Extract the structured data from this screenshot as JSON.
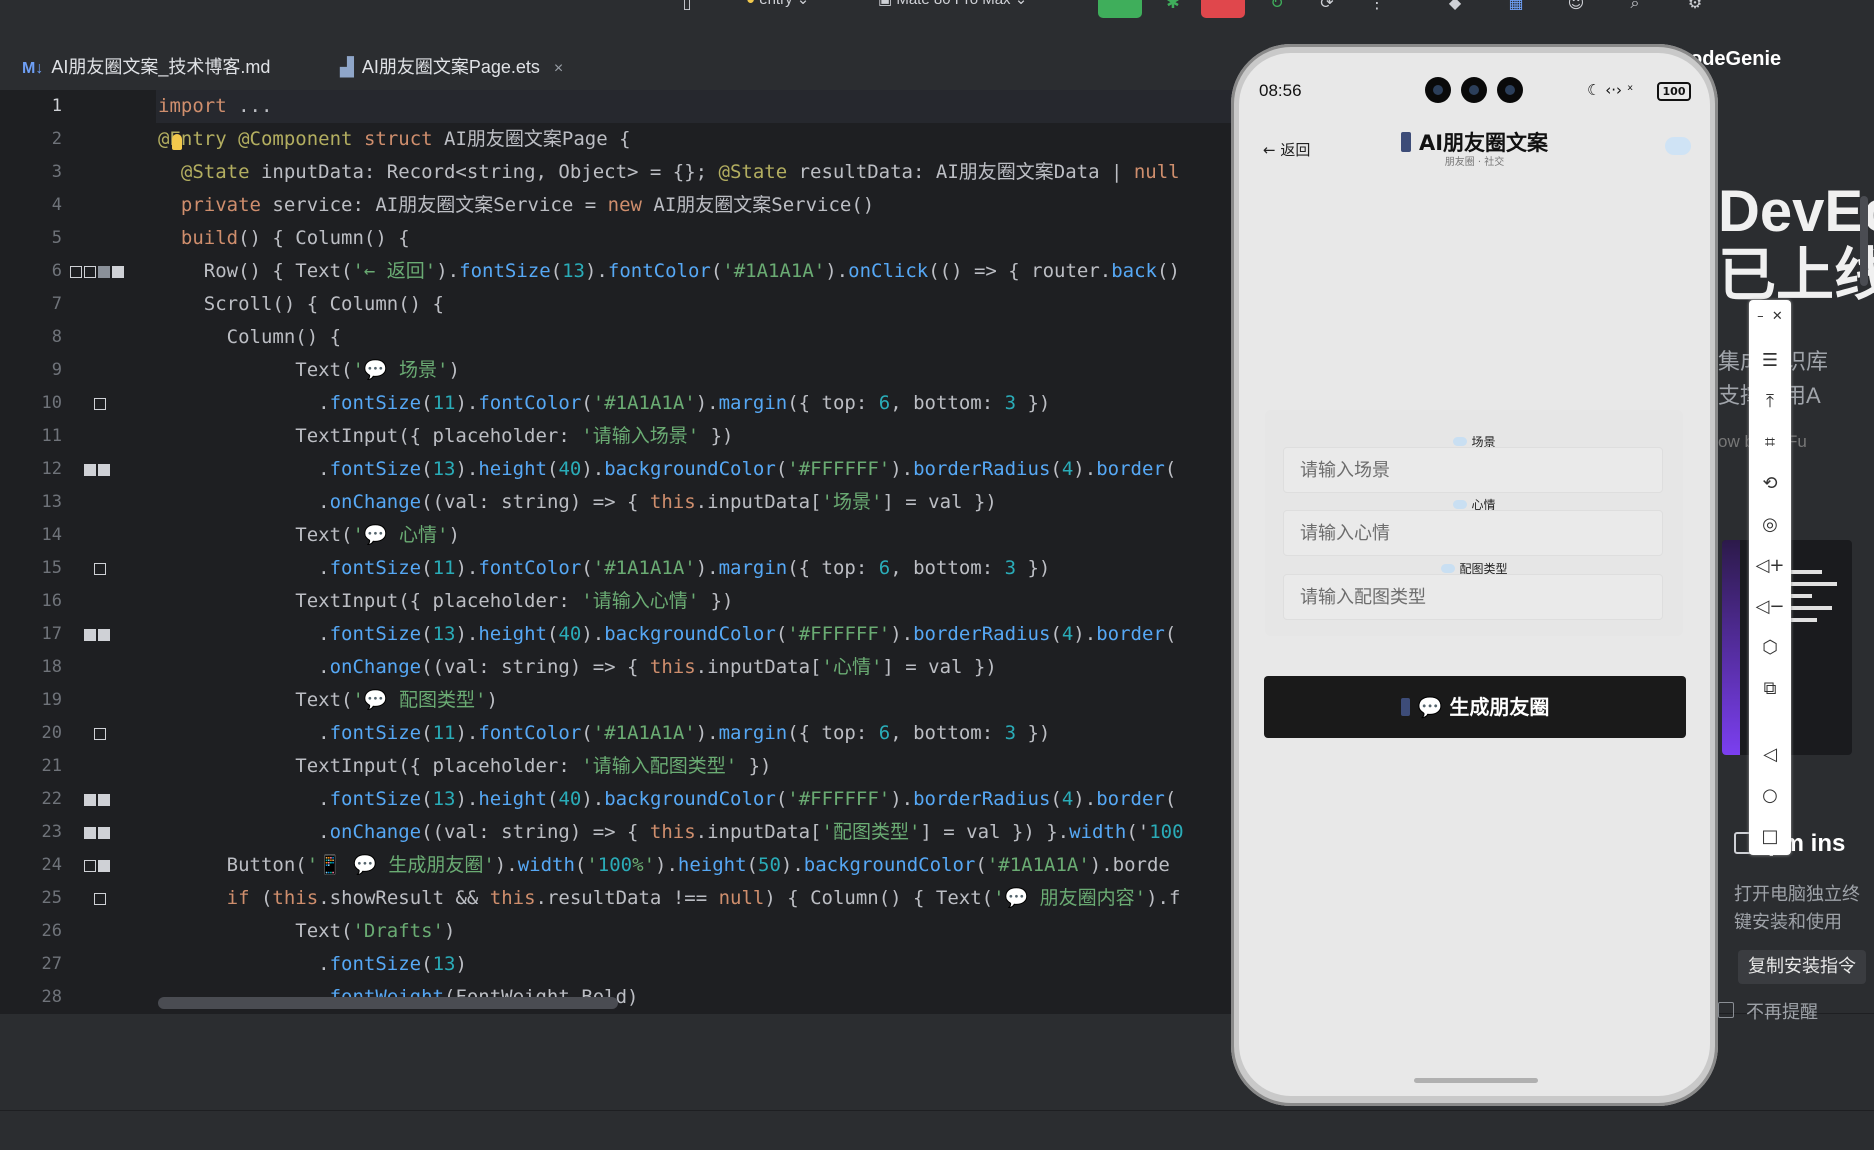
{
  "toolbar": {
    "entry": "entry",
    "device": "Mate 80 Pro Max",
    "colors": {
      "run": "#3fae5b",
      "stop": "#e0474c"
    }
  },
  "tabs": [
    {
      "icon": "M↓",
      "label": "AI朋友圈文案_技术博客.md"
    },
    {
      "label": "AI朋友圈文案Page.ets",
      "close": "×"
    }
  ],
  "editor": {
    "lines": [
      {
        "n": "1",
        "t": "import ..."
      },
      {
        "n": "2",
        "t": "@Entry @Component struct AI朋友圈文案Page {"
      },
      {
        "n": "3",
        "t": "  @State inputData: Record<string, Object> = {}; @State resultData: AI朋友圈文案Data | null"
      },
      {
        "n": "4",
        "t": "  private service: AI朋友圈文案Service = new AI朋友圈文案Service()"
      },
      {
        "n": "5",
        "t": "  build() { Column() {"
      },
      {
        "n": "6",
        "t": "    Row() { Text('← 返回').fontSize(13).fontColor('#1A1A1A').onClick(() => { router.back()"
      },
      {
        "n": "7",
        "t": "    Scroll() { Column() {"
      },
      {
        "n": "8",
        "t": "      Column() {"
      },
      {
        "n": "9",
        "t": "            Text('💬 场景')"
      },
      {
        "n": "10",
        "t": "              .fontSize(11).fontColor('#1A1A1A').margin({ top: 6, bottom: 3 })"
      },
      {
        "n": "11",
        "t": "            TextInput({ placeholder: '请输入场景' })"
      },
      {
        "n": "12",
        "t": "              .fontSize(13).height(40).backgroundColor('#FFFFFF').borderRadius(4).border("
      },
      {
        "n": "13",
        "t": "              .onChange((val: string) => { this.inputData['场景'] = val })"
      },
      {
        "n": "14",
        "t": "            Text('💬 心情')"
      },
      {
        "n": "15",
        "t": "              .fontSize(11).fontColor('#1A1A1A').margin({ top: 6, bottom: 3 })"
      },
      {
        "n": "16",
        "t": "            TextInput({ placeholder: '请输入心情' })"
      },
      {
        "n": "17",
        "t": "              .fontSize(13).height(40).backgroundColor('#FFFFFF').borderRadius(4).border("
      },
      {
        "n": "18",
        "t": "              .onChange((val: string) => { this.inputData['心情'] = val })"
      },
      {
        "n": "19",
        "t": "            Text('💬 配图类型')"
      },
      {
        "n": "20",
        "t": "              .fontSize(11).fontColor('#1A1A1A').margin({ top: 6, bottom: 3 })"
      },
      {
        "n": "21",
        "t": "            TextInput({ placeholder: '请输入配图类型' })"
      },
      {
        "n": "22",
        "t": "              .fontSize(13).height(40).backgroundColor('#FFFFFF').borderRadius(4).border("
      },
      {
        "n": "23",
        "t": "              .onChange((val: string) => { this.inputData['配图类型'] = val }) }.width('100"
      },
      {
        "n": "24",
        "t": "      Button('📱 💬 生成朋友圈').width('100%').height(50).backgroundColor('#1A1A1A').borde"
      },
      {
        "n": "25",
        "t": "      if (this.showResult && this.resultData !== null) { Column() { Text('💬 朋友圈内容').f"
      },
      {
        "n": "26",
        "t": "            Text('Drafts')"
      },
      {
        "n": "27",
        "t": "              .fontSize(13)"
      },
      {
        "n": "28",
        "t": "              .fontWeight(FontWeight.Bold)"
      }
    ]
  },
  "side": {
    "codegenie": "odeGenie",
    "hero1": "DevEc",
    "hero2": "已上线",
    "line1": "集成知识库",
    "line2": "支撑应用A",
    "line3": "ow      by BitFu",
    "pm": "pm ins",
    "desc1": "打开电脑独立终",
    "desc2": "键安装和使用",
    "copy": "复制安装指令",
    "nomore": "不再提醒"
  },
  "phone": {
    "time": "08:56",
    "status_icons": "☾ ‹·› ˣ",
    "battery": "100",
    "back": "← 返回",
    "title": "AI朋友圈文案",
    "subtitle": "朋友圈 · 社交",
    "fields": [
      {
        "label": "场景",
        "placeholder": "请输入场景"
      },
      {
        "label": "心情",
        "placeholder": "请输入心情"
      },
      {
        "label": "配图类型",
        "placeholder": "请输入配图类型"
      }
    ],
    "generate": "💬 生成朋友圈"
  }
}
